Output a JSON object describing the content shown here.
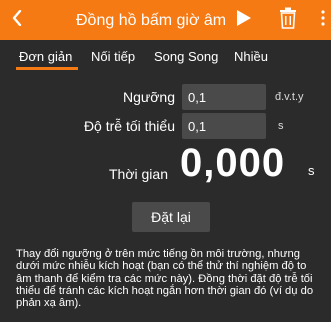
{
  "toolbar": {
    "title": "Đồng hồ bấm giờ âm",
    "back_icon": "chevron-left-icon",
    "play_icon": "play-icon",
    "trash_icon": "trash-icon",
    "more_icon": "more-vertical-icon",
    "accent_color": "#f57a14"
  },
  "tabs": [
    {
      "label": "Đơn giản",
      "active": true
    },
    {
      "label": "Nối tiếp",
      "active": false
    },
    {
      "label": "Song Song",
      "active": false
    },
    {
      "label": "Nhiều",
      "active": false
    }
  ],
  "form": {
    "threshold": {
      "label": "Ngưỡng",
      "value": "0,1",
      "unit": "đ.v.t.y"
    },
    "min_delay": {
      "label": "Độ trễ tối thiểu",
      "value": "0,1",
      "unit": "s"
    }
  },
  "timer": {
    "label": "Thời gian",
    "value": "0,000",
    "unit": "s"
  },
  "reset_label": "Đặt lại",
  "help_text": "Thay đổi ngưỡng ở trên mức tiếng ồn môi trường, nhưng dưới mức nhiễu kích hoạt (bạn có thể thử thí nghiệm độ to âm thanh để kiểm tra các mức này). Đồng thời đặt độ trễ tối thiểu để tránh các kích hoạt ngắn hơn thời gian đó (ví dụ do phản xạ âm)."
}
